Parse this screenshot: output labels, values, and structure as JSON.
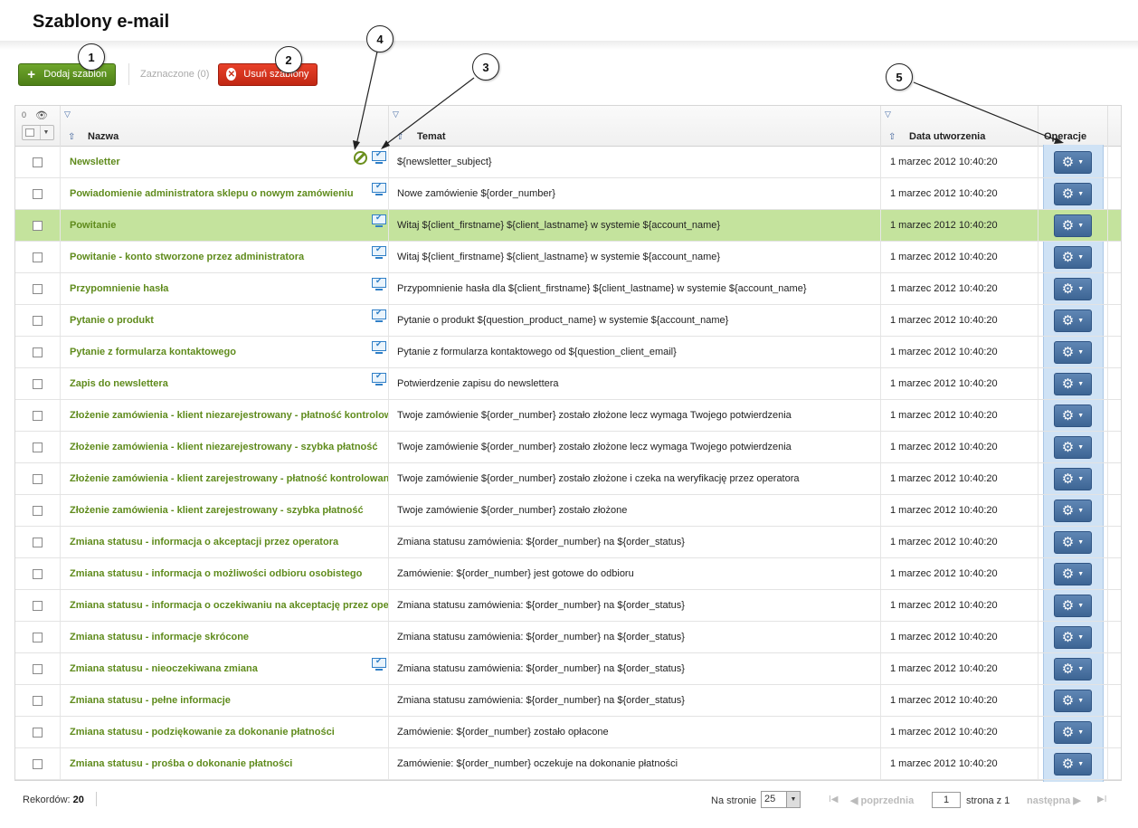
{
  "page": {
    "title": "Szablony e-mail"
  },
  "toolbar": {
    "add_label": "Dodaj szablon",
    "selected_label": "Zaznaczone (0)",
    "delete_label": "Usuń szablony"
  },
  "callouts": [
    "1",
    "2",
    "3",
    "4",
    "5"
  ],
  "table": {
    "selected_count": "0",
    "columns": {
      "name": "Nazwa",
      "subject": "Temat",
      "created": "Data utworzenia",
      "operations": "Operacje"
    },
    "rows": [
      {
        "name": "Newsletter",
        "subject": "${newsletter_subject}",
        "created": "1 marzec 2012 10:40:20",
        "blocked": true,
        "preview": true
      },
      {
        "name": "Powiadomienie administratora sklepu o nowym zamówieniu",
        "subject": "Nowe zamówienie ${order_number}",
        "created": "1 marzec 2012 10:40:20",
        "blocked": false,
        "preview": true
      },
      {
        "name": "Powitanie",
        "subject": "Witaj ${client_firstname} ${client_lastname} w systemie ${account_name}",
        "created": "1 marzec 2012 10:40:20",
        "blocked": false,
        "preview": true,
        "highlighted": true
      },
      {
        "name": "Powitanie - konto stworzone przez administratora",
        "subject": "Witaj ${client_firstname} ${client_lastname} w systemie ${account_name}",
        "created": "1 marzec 2012 10:40:20",
        "blocked": false,
        "preview": true
      },
      {
        "name": "Przypomnienie hasła",
        "subject": "Przypomnienie hasła dla ${client_firstname} ${client_lastname} w systemie ${account_name}",
        "created": "1 marzec 2012 10:40:20",
        "blocked": false,
        "preview": true
      },
      {
        "name": "Pytanie o produkt",
        "subject": "Pytanie o produkt ${question_product_name} w systemie ${account_name}",
        "created": "1 marzec 2012 10:40:20",
        "blocked": false,
        "preview": true
      },
      {
        "name": "Pytanie z formularza kontaktowego",
        "subject": "Pytanie z formularza kontaktowego od ${question_client_email}",
        "created": "1 marzec 2012 10:40:20",
        "blocked": false,
        "preview": true
      },
      {
        "name": "Zapis do newslettera",
        "subject": "Potwierdzenie zapisu do newslettera",
        "created": "1 marzec 2012 10:40:20",
        "blocked": false,
        "preview": true
      },
      {
        "name": "Złożenie zamówienia - klient niezarejestrowany - płatność kontrolowana",
        "subject": "Twoje zamówienie ${order_number} zostało złożone lecz wymaga Twojego potwierdzenia",
        "created": "1 marzec 2012 10:40:20",
        "blocked": false,
        "preview": false
      },
      {
        "name": "Złożenie zamówienia - klient niezarejestrowany - szybka płatność",
        "subject": "Twoje zamówienie ${order_number} zostało złożone lecz wymaga Twojego potwierdzenia",
        "created": "1 marzec 2012 10:40:20",
        "blocked": false,
        "preview": false
      },
      {
        "name": "Złożenie zamówienia - klient zarejestrowany - płatność kontrolowana",
        "subject": "Twoje zamówienie ${order_number} zostało złożone i czeka na weryfikację przez operatora",
        "created": "1 marzec 2012 10:40:20",
        "blocked": false,
        "preview": false
      },
      {
        "name": "Złożenie zamówienia - klient zarejestrowany - szybka płatność",
        "subject": "Twoje zamówienie ${order_number} zostało złożone",
        "created": "1 marzec 2012 10:40:20",
        "blocked": false,
        "preview": false
      },
      {
        "name": "Zmiana statusu - informacja o akceptacji przez operatora",
        "subject": "Zmiana statusu zamówienia: ${order_number} na ${order_status}",
        "created": "1 marzec 2012 10:40:20",
        "blocked": false,
        "preview": false
      },
      {
        "name": "Zmiana statusu - informacja o możliwości odbioru osobistego",
        "subject": "Zamówienie: ${order_number} jest gotowe do odbioru",
        "created": "1 marzec 2012 10:40:20",
        "blocked": false,
        "preview": false
      },
      {
        "name": "Zmiana statusu - informacja o oczekiwaniu na akceptację przez operatora",
        "subject": "Zmiana statusu zamówienia: ${order_number} na ${order_status}",
        "created": "1 marzec 2012 10:40:20",
        "blocked": false,
        "preview": false
      },
      {
        "name": "Zmiana statusu - informacje skrócone",
        "subject": "Zmiana statusu zamówienia: ${order_number} na ${order_status}",
        "created": "1 marzec 2012 10:40:20",
        "blocked": false,
        "preview": false
      },
      {
        "name": "Zmiana statusu - nieoczekiwana zmiana",
        "subject": "Zmiana statusu zamówienia: ${order_number} na ${order_status}",
        "created": "1 marzec 2012 10:40:20",
        "blocked": false,
        "preview": true
      },
      {
        "name": "Zmiana statusu - pełne informacje",
        "subject": "Zmiana statusu zamówienia: ${order_number} na ${order_status}",
        "created": "1 marzec 2012 10:40:20",
        "blocked": false,
        "preview": false
      },
      {
        "name": "Zmiana statusu - podziękowanie za dokonanie płatności",
        "subject": "Zamówienie: ${order_number} zostało opłacone",
        "created": "1 marzec 2012 10:40:20",
        "blocked": false,
        "preview": false
      },
      {
        "name": "Zmiana statusu - prośba o dokonanie płatności",
        "subject": "Zamówienie: ${order_number} oczekuje na dokonanie płatności",
        "created": "1 marzec 2012 10:40:20",
        "blocked": false,
        "preview": false
      }
    ]
  },
  "footer": {
    "records_label": "Rekordów:",
    "records_count": "20",
    "per_page_label": "Na stronie",
    "per_page_value": "25",
    "prev_label": "poprzednia",
    "page_value": "1",
    "page_of_label": "strona z 1",
    "next_label": "następna"
  },
  "colors": {
    "accent_green": "#5f8b1c",
    "highlight_row": "#c4e39d",
    "delete_red": "#d23520",
    "ops_blue": "#4a72a3"
  },
  "icons": [
    "plus-icon",
    "delete-icon",
    "filter-icon",
    "eye-icon",
    "sort-asc-icon",
    "block-icon",
    "preview-icon",
    "gear-icon"
  ]
}
